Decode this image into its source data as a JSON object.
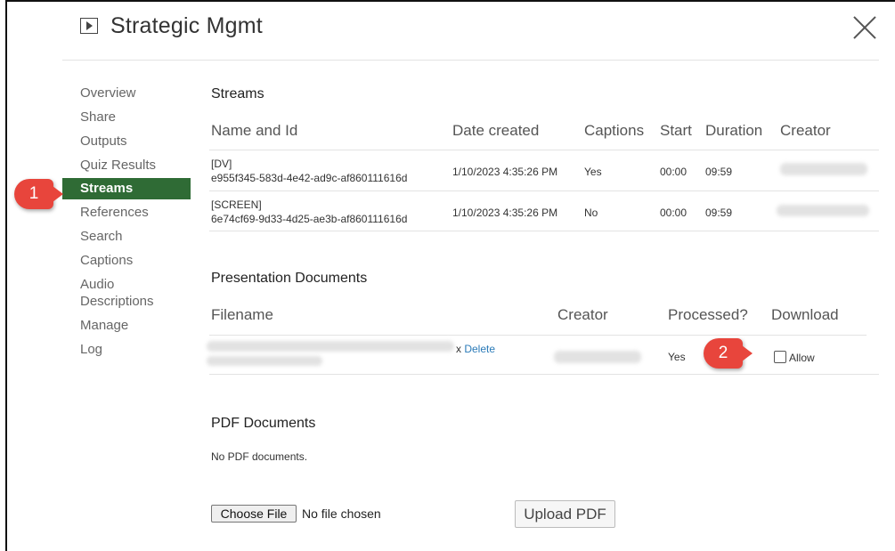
{
  "header": {
    "title": "Strategic Mgmt"
  },
  "nav": {
    "items": [
      {
        "label": "Overview"
      },
      {
        "label": "Share"
      },
      {
        "label": "Outputs"
      },
      {
        "label": "Quiz Results"
      },
      {
        "label": "Streams",
        "active": true
      },
      {
        "label": "References"
      },
      {
        "label": "Search"
      },
      {
        "label": "Captions"
      },
      {
        "label": "Audio\nDescriptions"
      },
      {
        "label": "Manage"
      },
      {
        "label": "Log"
      }
    ]
  },
  "callouts": [
    "1",
    "2"
  ],
  "streams": {
    "heading": "Streams",
    "columns": [
      "Name and Id",
      "Date created",
      "Captions",
      "Start",
      "Duration",
      "Creator"
    ],
    "rows": [
      {
        "name": "[DV]",
        "id": "e955f345-583d-4e42-ad9c-af860111616d",
        "date": "1/10/2023 4:35:26 PM",
        "captions": "Yes",
        "start": "00:00",
        "duration": "09:59"
      },
      {
        "name": "[SCREEN]",
        "id": "6e74cf69-9d33-4d25-ae3b-af860111616d",
        "date": "1/10/2023 4:35:26 PM",
        "captions": "No",
        "start": "00:00",
        "duration": "09:59"
      }
    ]
  },
  "presentation": {
    "heading": "Presentation Documents",
    "columns": [
      "Filename",
      "Creator",
      "Processed?",
      "Download"
    ],
    "rows": [
      {
        "delete_prefix": "x",
        "delete_label": "Delete",
        "processed": "Yes",
        "allow_label": "Allow"
      }
    ]
  },
  "pdf": {
    "heading": "PDF Documents",
    "empty_text": "No PDF documents.",
    "choose_file_label": "Choose File",
    "no_file_text": "No file chosen",
    "upload_label": "Upload PDF"
  },
  "colors": {
    "active_nav": "#2f6b35",
    "callout": "#e8453c",
    "link": "#2a7ab8"
  }
}
